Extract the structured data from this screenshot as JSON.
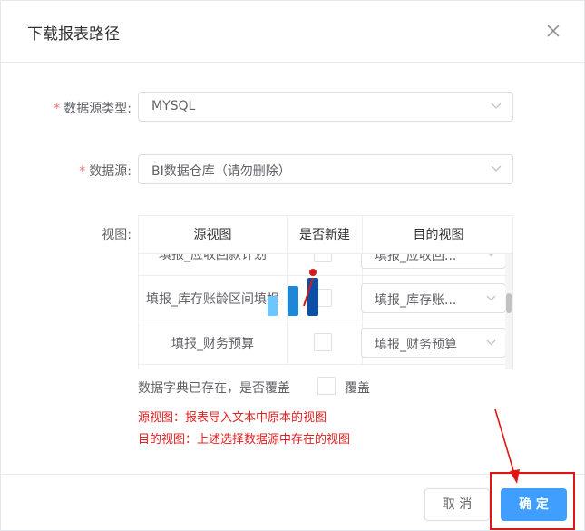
{
  "dialog": {
    "title": "下载报表路径",
    "close_icon": "close-icon"
  },
  "form": {
    "datasource_type": {
      "label": "数据源类型:",
      "value": "MYSQL",
      "required": true
    },
    "datasource": {
      "label": "数据源:",
      "value": "BI数据仓库（请勿删除）",
      "required": true
    },
    "views": {
      "label": "视图:"
    }
  },
  "table": {
    "columns": [
      "源视图",
      "是否新建",
      "目的视图"
    ],
    "rows": [
      {
        "source": "填报_应收回款计划",
        "target": "填报_应收回..."
      },
      {
        "source": "填报_库存账龄区间填报",
        "target": "填报_库存账..."
      },
      {
        "source": "填报_财务预算",
        "target": "填报_财务预算"
      }
    ]
  },
  "overwrite": {
    "question": "数据字典已存在，是否覆盖",
    "label": "覆盖"
  },
  "notes": {
    "source_view": "源视图：报表导入文本中原本的视图",
    "target_view": "目的视图：上述选择数据源中存在的视图"
  },
  "footer": {
    "cancel_label": "取 消",
    "ok_label": "确 定"
  },
  "colors": {
    "primary": "#409eff",
    "annotation_red": "#e01515",
    "required_star": "#f56c6c"
  }
}
